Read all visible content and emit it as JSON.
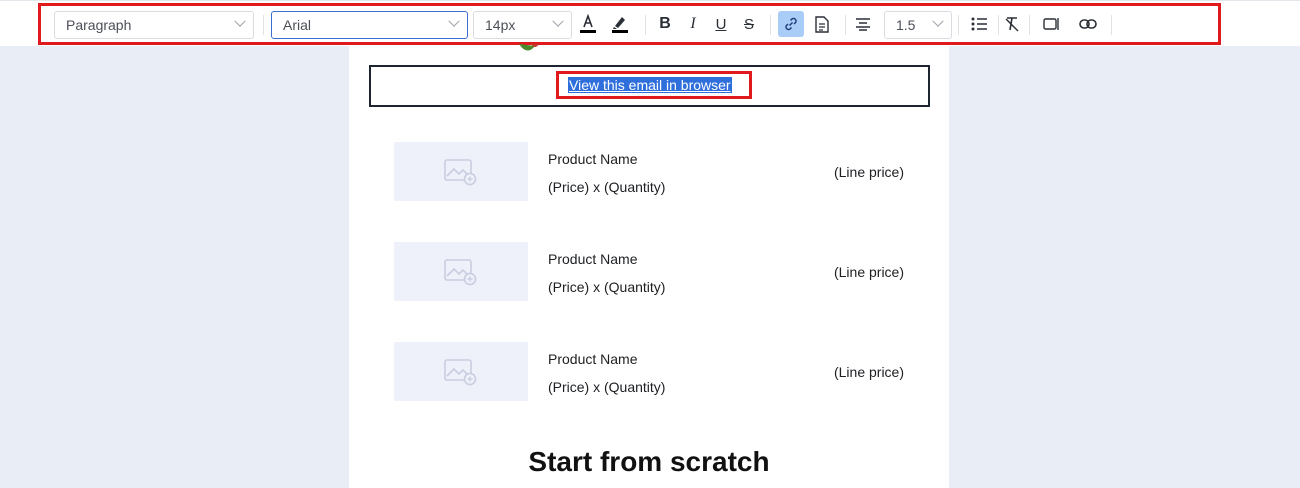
{
  "toolbar": {
    "block_format": "Paragraph",
    "font_family": "Arial",
    "font_size": "14px",
    "line_height": "1.5",
    "text_color": "#000000",
    "buttons": {
      "bold": "B",
      "italic": "I",
      "underline": "U",
      "strike": "S"
    }
  },
  "email": {
    "browser_link": "View this email in browser",
    "products": [
      {
        "name": "Product Name",
        "qty": "(Price) x (Quantity)",
        "line_price": "(Line price)"
      },
      {
        "name": "Product Name",
        "qty": "(Price) x (Quantity)",
        "line_price": "(Line price)"
      },
      {
        "name": "Product Name",
        "qty": "(Price) x (Quantity)",
        "line_price": "(Line price)"
      }
    ],
    "heading": "Start from scratch"
  },
  "colors": {
    "highlight_border": "#e0191d",
    "selection": "#2f6fdc",
    "page_bg": "#e9edf5",
    "thumb_bg": "#eef0fa",
    "active_button": "#a9cdf7"
  }
}
